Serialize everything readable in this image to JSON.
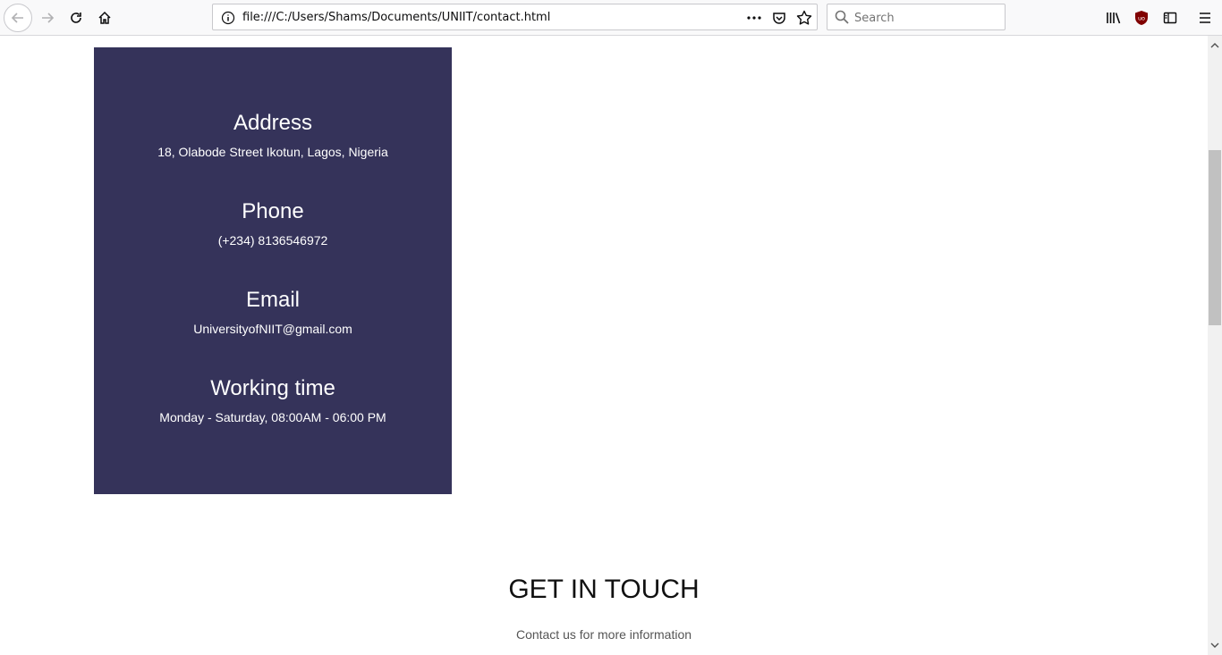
{
  "browser": {
    "url": "file:///C:/Users/Shams/Documents/UNIIT/contact.html",
    "search_placeholder": "Search"
  },
  "contact_info": [
    {
      "title": "Address",
      "value": "18, Olabode Street Ikotun, Lagos, Nigeria"
    },
    {
      "title": "Phone",
      "value": "(+234) 8136546972"
    },
    {
      "title": "Email",
      "value": "UniversityofNIIT@gmail.com"
    },
    {
      "title": "Working time",
      "value": "Monday - Saturday, 08:00AM - 06:00 PM"
    }
  ],
  "get_in_touch": {
    "title": "GET IN TOUCH",
    "subtitle": "Contact us for more information"
  },
  "colors": {
    "panel_bg": "#35335a",
    "panel_text": "#ffffff"
  }
}
